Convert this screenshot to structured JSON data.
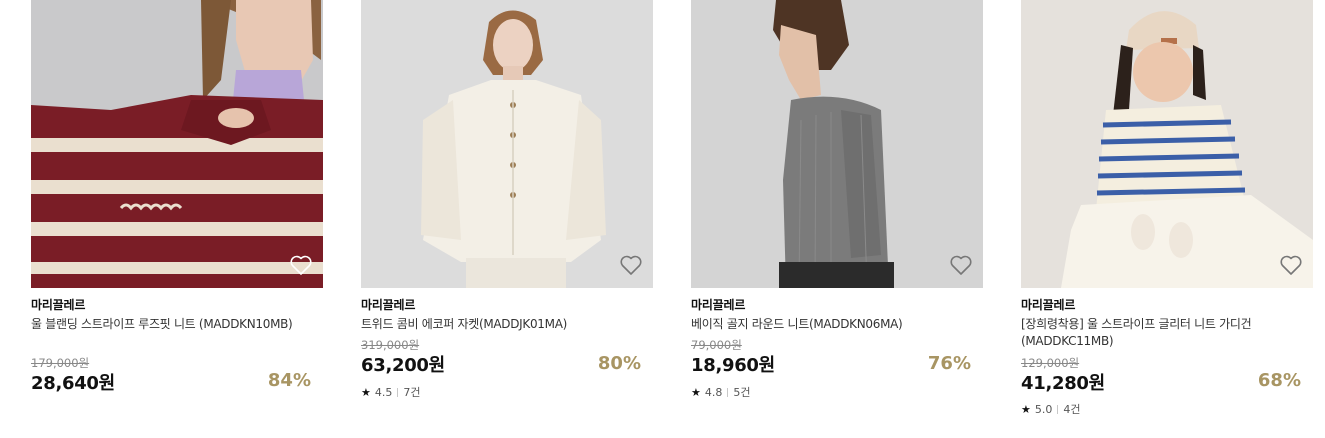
{
  "products": [
    {
      "brand": "마리끌레르",
      "name": "울 블랜딩 스트라이프 루즈핏 니트 (MADDKN10MB)",
      "original_price": "179,000원",
      "price": "28,640원",
      "discount": "84%",
      "rating": null,
      "review_count": null,
      "image": "model-burgundy-stripe-knit",
      "wishlist_icon": "heart-outline-icon",
      "colors": {
        "bg": "#c9c9cb",
        "garment": "#7a1d26",
        "stripe": "#eadfcf"
      }
    },
    {
      "brand": "마리끌레르",
      "name": "트위드 콤비 에코퍼 자켓(MADDJK01MA)",
      "original_price": "319,000원",
      "price": "63,200원",
      "discount": "80%",
      "rating": "4.5",
      "review_count": "7건",
      "image": "model-white-tweed-jacket",
      "wishlist_icon": "heart-outline-icon",
      "colors": {
        "bg": "#dcdcdc",
        "garment": "#f3efe6"
      }
    },
    {
      "brand": "마리끌레르",
      "name": "베이직 골지 라운드 니트(MADDKN06MA)",
      "original_price": "79,000원",
      "price": "18,960원",
      "discount": "76%",
      "rating": "4.8",
      "review_count": "5건",
      "image": "model-grey-rib-knit",
      "wishlist_icon": "heart-outline-icon",
      "colors": {
        "bg": "#d4d4d4",
        "garment": "#7b7b7b"
      }
    },
    {
      "brand": "마리끌레르",
      "name": "[장희령착용] 울 스트라이프 글리터 니트 가디건 (MADDKC11MB)",
      "original_price": "129,000원",
      "price": "41,280원",
      "discount": "68%",
      "rating": "5.0",
      "review_count": "4건",
      "image": "model-blue-stripe-cardigan",
      "wishlist_icon": "heart-outline-icon",
      "colors": {
        "bg": "#e5e1dc",
        "garment": "#f4eedf",
        "stripe": "#3b5fa8"
      }
    }
  ],
  "theme": {
    "discount_color": "#a89563",
    "price_color": "#111111",
    "original_price_color": "#888888"
  }
}
